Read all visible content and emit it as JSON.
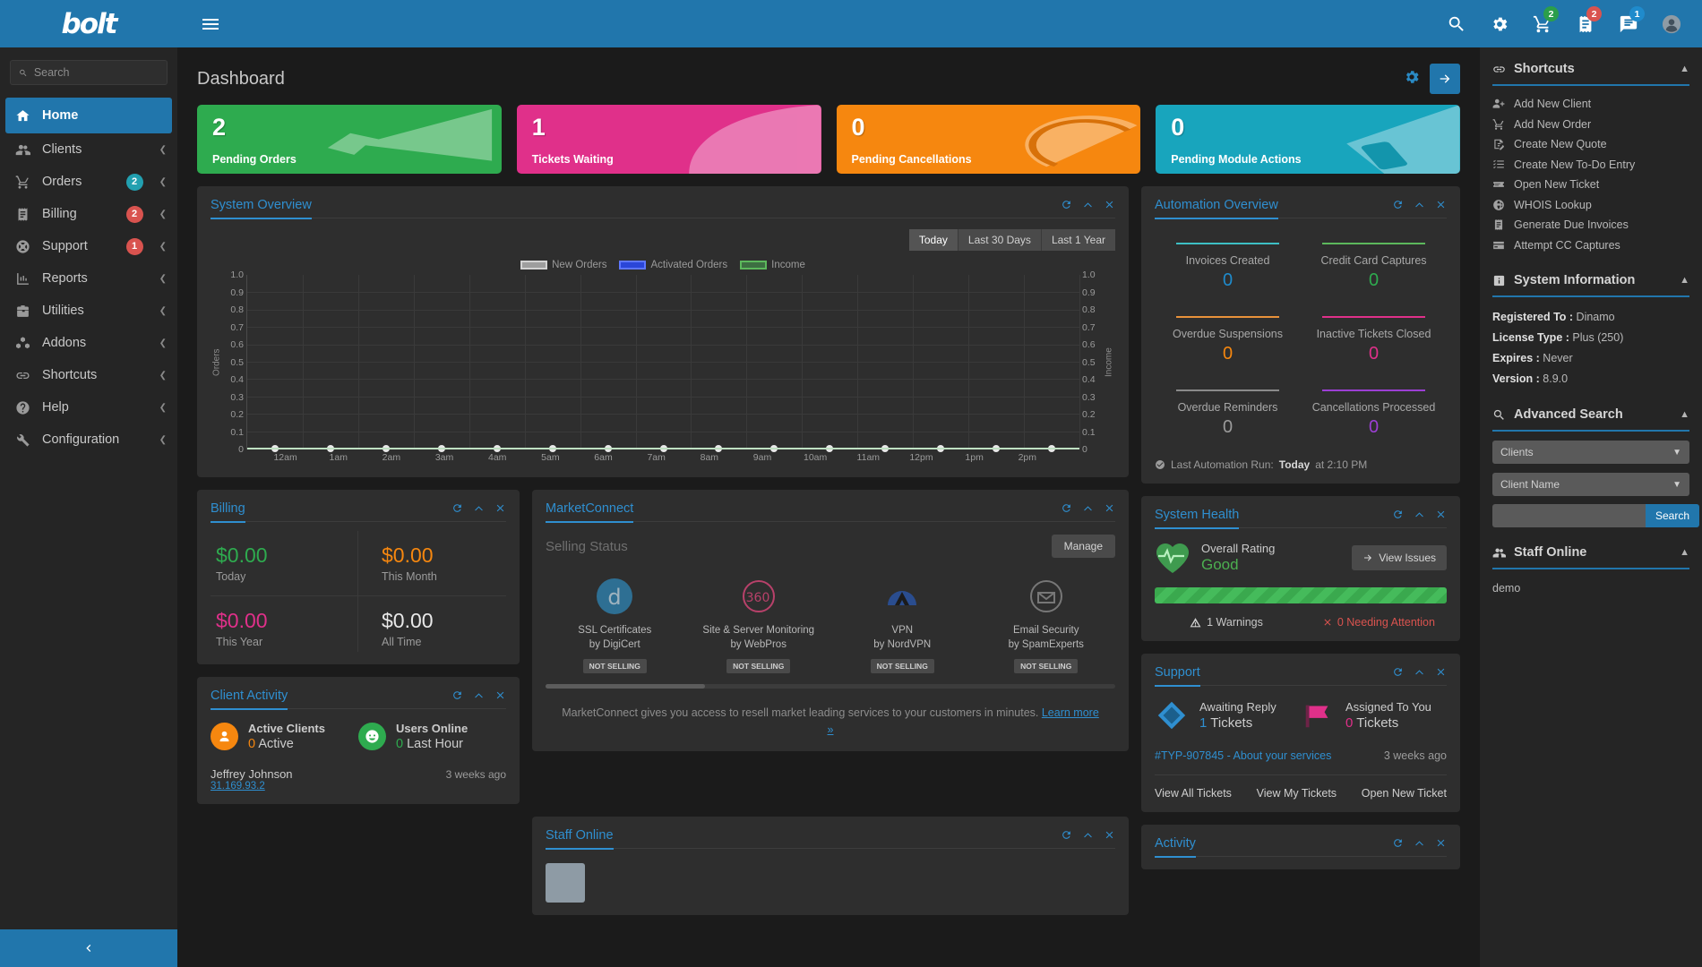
{
  "topbar": {
    "logo": "bolt",
    "menu_icon": "hamburger-icon",
    "icons": [
      {
        "name": "search-icon",
        "badge": null
      },
      {
        "name": "gear-icon",
        "badge": null
      },
      {
        "name": "cart-icon",
        "badge": "2",
        "badge_color": "#2b9e4b"
      },
      {
        "name": "invoice-icon",
        "badge": "2",
        "badge_color": "#d9534f"
      },
      {
        "name": "support-icon",
        "badge": "1",
        "badge_color": "#1f8bcc"
      },
      {
        "name": "avatar-icon",
        "badge": null
      }
    ]
  },
  "sidebar": {
    "search_placeholder": "Search",
    "items": [
      {
        "label": "Home",
        "icon": "home-icon",
        "active": true,
        "badge": null,
        "badge_type": "",
        "chevron": false
      },
      {
        "label": "Clients",
        "icon": "users-icon",
        "active": false,
        "badge": null,
        "badge_type": "",
        "chevron": true
      },
      {
        "label": "Orders",
        "icon": "cart-icon",
        "active": false,
        "badge": "2",
        "badge_type": "nb-teal",
        "chevron": true
      },
      {
        "label": "Billing",
        "icon": "invoice-icon",
        "active": false,
        "badge": "2",
        "badge_type": "nb-red",
        "chevron": true
      },
      {
        "label": "Support",
        "icon": "lifering-icon",
        "active": false,
        "badge": "1",
        "badge_type": "nb-red",
        "chevron": true
      },
      {
        "label": "Reports",
        "icon": "chart-icon",
        "active": false,
        "badge": null,
        "badge_type": "",
        "chevron": true
      },
      {
        "label": "Utilities",
        "icon": "toolbox-icon",
        "active": false,
        "badge": null,
        "badge_type": "",
        "chevron": true
      },
      {
        "label": "Addons",
        "icon": "cubes-icon",
        "active": false,
        "badge": null,
        "badge_type": "",
        "chevron": true
      },
      {
        "label": "Shortcuts",
        "icon": "link-icon",
        "active": false,
        "badge": null,
        "badge_type": "",
        "chevron": true
      },
      {
        "label": "Help",
        "icon": "question-icon",
        "active": false,
        "badge": null,
        "badge_type": "",
        "chevron": true
      },
      {
        "label": "Configuration",
        "icon": "wrench-icon",
        "active": false,
        "badge": null,
        "badge_type": "",
        "chevron": true
      }
    ],
    "collapse_icon": "chevron-left-icon"
  },
  "main": {
    "page_title": "Dashboard",
    "settings_icon": "gear-icon",
    "expand_icon": "arrow-right-icon",
    "stat_cards": [
      {
        "value": "2",
        "label": "Pending Orders",
        "color": "#2eab4f",
        "shape": "megaphone"
      },
      {
        "value": "1",
        "label": "Tickets Waiting",
        "color": "#e0308a",
        "shape": "ticket"
      },
      {
        "value": "0",
        "label": "Pending Cancellations",
        "color": "#f6870f",
        "shape": "ban"
      },
      {
        "value": "0",
        "label": "Pending Module Actions",
        "color": "#18a5bd",
        "shape": "module"
      }
    ]
  },
  "system_overview": {
    "title": "System Overview",
    "ranges": [
      {
        "label": "Today",
        "active": true
      },
      {
        "label": "Last 30 Days",
        "active": false
      },
      {
        "label": "Last 1 Year",
        "active": false
      }
    ]
  },
  "chart_data": {
    "type": "line",
    "title": "System Overview",
    "xlabel": "",
    "ylabel": "Orders",
    "y2label": "Income",
    "ylim": [
      0,
      1
    ],
    "y2lim": [
      0,
      1
    ],
    "yticks": [
      "0",
      "0.1",
      "0.2",
      "0.3",
      "0.4",
      "0.5",
      "0.6",
      "0.7",
      "0.8",
      "0.9",
      "1.0"
    ],
    "y2ticks": [
      "0",
      "0.1",
      "0.2",
      "0.3",
      "0.4",
      "0.5",
      "0.6",
      "0.7",
      "0.8",
      "0.9",
      "1.0"
    ],
    "categories": [
      "12am",
      "1am",
      "2am",
      "3am",
      "4am",
      "5am",
      "6am",
      "7am",
      "8am",
      "9am",
      "10am",
      "11am",
      "12pm",
      "1pm",
      "2pm"
    ],
    "grid": true,
    "legend_position": "top-center",
    "series": [
      {
        "name": "New Orders",
        "color": "#9e9e9e",
        "values": [
          0,
          0,
          0,
          0,
          0,
          0,
          0,
          0,
          0,
          0,
          0,
          0,
          0,
          0,
          0
        ]
      },
      {
        "name": "Activated Orders",
        "color": "#2a46d8",
        "values": [
          0,
          0,
          0,
          0,
          0,
          0,
          0,
          0,
          0,
          0,
          0,
          0,
          0,
          0,
          0
        ]
      },
      {
        "name": "Income",
        "color": "#5cb85c",
        "values": [
          0,
          0,
          0,
          0,
          0,
          0,
          0,
          0,
          0,
          0,
          0,
          0,
          0,
          0,
          0
        ]
      }
    ]
  },
  "billing": {
    "title": "Billing",
    "cells": [
      {
        "amount": "$0.00",
        "label": "Today",
        "color": "#2eab4f"
      },
      {
        "amount": "$0.00",
        "label": "This Month",
        "color": "#f6870f"
      },
      {
        "amount": "$0.00",
        "label": "This Year",
        "color": "#e0308a"
      },
      {
        "amount": "$0.00",
        "label": "All Time",
        "color": "#e8e8e8"
      }
    ]
  },
  "client_activity": {
    "title": "Client Activity",
    "stats": [
      {
        "title": "Active Clients",
        "value": "0",
        "suffix": "Active",
        "color": "#f6870f",
        "icon": "user-icon",
        "bg": "#f6870f"
      },
      {
        "title": "Users Online",
        "value": "0",
        "suffix": "Last Hour",
        "color": "#2eab4f",
        "icon": "smile-icon",
        "bg": "#2eab4f"
      }
    ],
    "entries": [
      {
        "name": "Jeffrey Johnson",
        "ip": "31.169.93.2",
        "time": "3 weeks ago"
      }
    ]
  },
  "marketconnect": {
    "title": "MarketConnect",
    "selling_status": "Selling Status",
    "manage_label": "Manage",
    "products": [
      {
        "name": "SSL Certificates",
        "vendor": "by DigiCert",
        "status": "NOT SELLING",
        "logo": "digicert-logo"
      },
      {
        "name": "Site & Server Monitoring",
        "vendor": "by WebPros",
        "status": "NOT SELLING",
        "logo": "360-logo"
      },
      {
        "name": "VPN",
        "vendor": "by NordVPN",
        "status": "NOT SELLING",
        "logo": "nordvpn-logo"
      },
      {
        "name": "Email Security",
        "vendor": "by SpamExperts",
        "status": "NOT SELLING",
        "logo": "spamexperts-logo"
      }
    ],
    "footer_text": "MarketConnect gives you access to resell market leading services to your customers in minutes.",
    "footer_link": "Learn more »"
  },
  "staff_online_main": {
    "title": "Staff Online"
  },
  "automation": {
    "title": "Automation Overview",
    "cells": [
      {
        "label": "Invoices Created",
        "value": "0",
        "color": "#1f8bcc",
        "bar": "#3dbfc4"
      },
      {
        "label": "Credit Card Captures",
        "value": "0",
        "color": "#2eab4f",
        "bar": "#5cb85c"
      },
      {
        "label": "Overdue Suspensions",
        "value": "0",
        "color": "#f6870f",
        "bar": "#e8913a"
      },
      {
        "label": "Inactive Tickets Closed",
        "value": "0",
        "color": "#e0308a",
        "bar": "#e0308a"
      },
      {
        "label": "Overdue Reminders",
        "value": "0",
        "color": "#9b9b9b",
        "bar": "#8a8a8a"
      },
      {
        "label": "Cancellations Processed",
        "value": "0",
        "color": "#9c3fd4",
        "bar": "#9c3fd4"
      }
    ],
    "last_run_prefix": "Last Automation Run:",
    "last_run_day": "Today",
    "last_run_time": "at 2:10 PM"
  },
  "system_health": {
    "title": "System Health",
    "rating_label": "Overall Rating",
    "rating_value": "Good",
    "view_issues": "View Issues",
    "warnings": "1 Warnings",
    "attention": "0 Needing Attention",
    "bar_color": "#3aa94e"
  },
  "support": {
    "title": "Support",
    "stats": [
      {
        "label": "Awaiting Reply",
        "value": "1",
        "suffix": "Tickets",
        "color": "#1f8bcc",
        "icon": "diamond-icon"
      },
      {
        "label": "Assigned To You",
        "value": "0",
        "suffix": "Tickets",
        "color": "#e0308a",
        "icon": "flag-icon"
      }
    ],
    "ticket": {
      "id": "#TYP-907845 - About your services",
      "ago": "3 weeks ago"
    },
    "links": [
      "View All Tickets",
      "View My Tickets",
      "Open New Ticket"
    ]
  },
  "activity": {
    "title": "Activity"
  },
  "rightbar": {
    "shortcuts": {
      "title": "Shortcuts",
      "icon": "link-icon",
      "items": [
        {
          "label": "Add New Client",
          "icon": "user-plus-icon"
        },
        {
          "label": "Add New Order",
          "icon": "cart-plus-icon"
        },
        {
          "label": "Create New Quote",
          "icon": "quote-icon"
        },
        {
          "label": "Create New To-Do Entry",
          "icon": "list-icon"
        },
        {
          "label": "Open New Ticket",
          "icon": "ticket-icon"
        },
        {
          "label": "WHOIS Lookup",
          "icon": "globe-icon"
        },
        {
          "label": "Generate Due Invoices",
          "icon": "invoice-icon"
        },
        {
          "label": "Attempt CC Captures",
          "icon": "creditcard-icon"
        }
      ]
    },
    "system_information": {
      "title": "System Information",
      "icon": "info-icon",
      "rows": [
        {
          "label": "Registered To :",
          "value": "Dinamo"
        },
        {
          "label": "License Type :",
          "value": "Plus (250)"
        },
        {
          "label": "Expires :",
          "value": "Never"
        },
        {
          "label": "Version :",
          "value": "8.9.0"
        }
      ]
    },
    "advanced_search": {
      "title": "Advanced Search",
      "icon": "search-icon",
      "select_type": "Clients",
      "select_field": "Client Name",
      "input_value": "",
      "button_label": "Search"
    },
    "staff_online": {
      "title": "Staff Online",
      "icon": "users-icon",
      "users": [
        "demo"
      ]
    }
  }
}
